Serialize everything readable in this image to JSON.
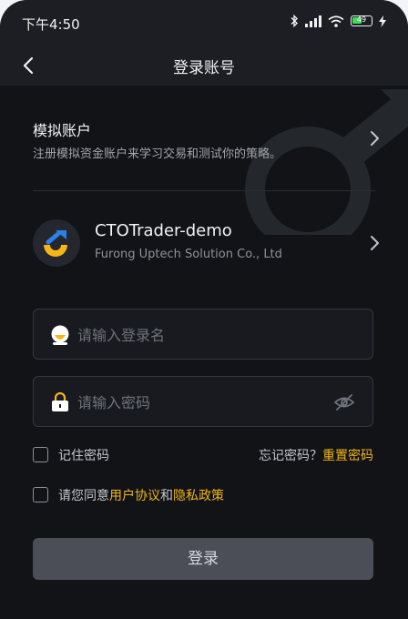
{
  "status_bar": {
    "time": "下午4:50",
    "battery": "49",
    "icons": [
      "bluetooth-icon",
      "signal-icon",
      "wifi-icon",
      "battery-icon",
      "charging-icon"
    ]
  },
  "nav": {
    "title": "登录账号",
    "back_icon": "chevron-left-icon"
  },
  "demo_account": {
    "title": "模拟账户",
    "description": "注册模拟资金账户来学习交易和测试你的策略。"
  },
  "broker": {
    "name": "CTOTrader-demo",
    "company": "Furong Uptech Solution Co., Ltd"
  },
  "form": {
    "username_placeholder": "请输入登录名",
    "password_placeholder": "请输入密码",
    "remember_label": "记住密码",
    "forgot_label": "忘记密码？",
    "reset_link": "重置密码",
    "agree_prefix": "请您同意",
    "user_agreement_link": "用户协议",
    "agree_and": "和",
    "privacy_link": "隐私政策",
    "login_label": "登录"
  },
  "colors": {
    "background": "#111317",
    "accent": "#f1b519",
    "button": "#4b4e56",
    "logo_blue": "#2f7fe8",
    "logo_yellow": "#f6b616"
  }
}
